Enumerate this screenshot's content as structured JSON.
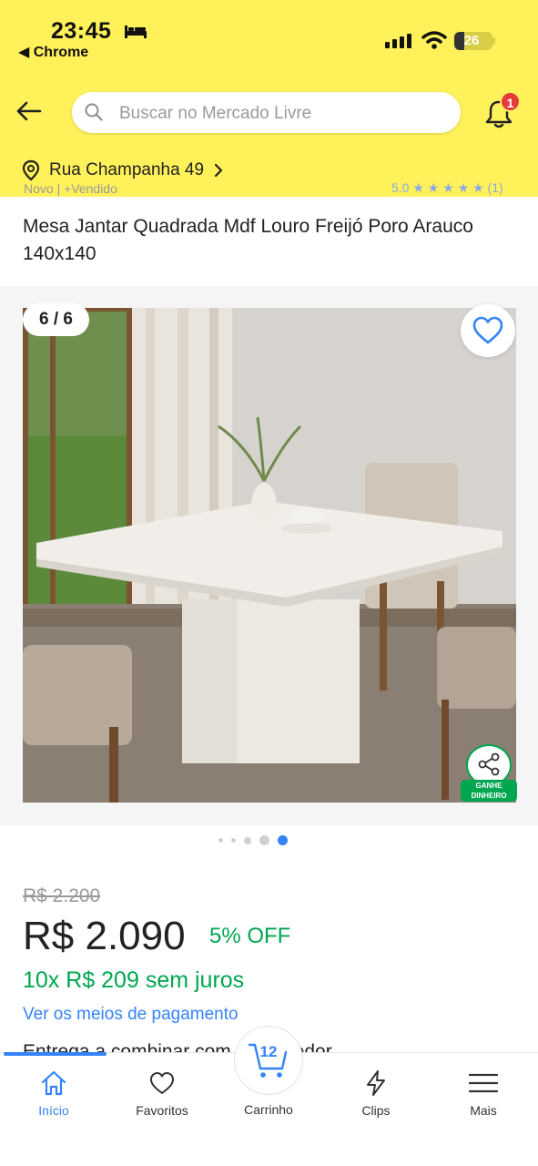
{
  "status_bar": {
    "time": "23:45",
    "back_app": "Chrome",
    "battery": "26",
    "battery_level": 0.26
  },
  "header": {
    "search_placeholder": "Buscar no Mercado Livre",
    "notification_count": "1",
    "address": "Rua Champanha 49"
  },
  "product": {
    "partial_top_text": "Novo  |  +Vendido",
    "partial_rating_text": "5.0 ★ ★ ★ ★ ★ (1)",
    "title": "Mesa Jantar Quadrada Mdf Louro Freijó Poro Arauco 140x140",
    "image_counter": "6 / 6",
    "earn_label_line1": "GANHE",
    "earn_label_line2": "DINHEIRO",
    "carousel": {
      "total": 5,
      "active_index": 4
    },
    "old_price": "R$ 2.200",
    "price": "R$ 2.090",
    "discount": "5% OFF",
    "installments": "10x R$ 209 sem juros",
    "payment_link": "Ver os meios de pagamento",
    "delivery_partial": "Entrega a combinar com o vendedor"
  },
  "tabbar": {
    "items": [
      {
        "label": "Início",
        "icon": "home-icon",
        "active": true
      },
      {
        "label": "Favoritos",
        "icon": "heart-icon",
        "active": false
      },
      {
        "label": "Carrinho",
        "icon": "cart-icon",
        "active": false
      },
      {
        "label": "Clips",
        "icon": "bolt-icon",
        "active": false
      },
      {
        "label": "Mais",
        "icon": "menu-icon",
        "active": false
      }
    ],
    "cart_count": "12"
  },
  "colors": {
    "brand_yellow": "#fff159",
    "accent_blue": "#3483fa",
    "success_green": "#00a650",
    "badge_red": "#e63b3b"
  }
}
